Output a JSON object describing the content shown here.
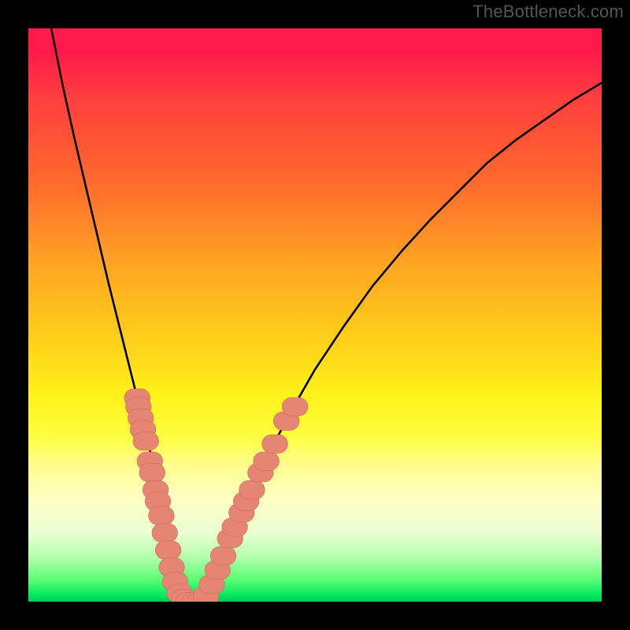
{
  "watermark": "TheBottleneck.com",
  "colors": {
    "curve_stroke": "#000000",
    "marker_fill": "#e58574",
    "marker_stroke": "#d06a5a"
  },
  "chart_data": {
    "type": "line",
    "title": "",
    "xlabel": "",
    "ylabel": "",
    "xlim": [
      0,
      100
    ],
    "ylim": [
      0,
      100
    ],
    "legend": false,
    "grid": false,
    "series": [
      {
        "name": "bottleneck-curve",
        "x": [
          4,
          6,
          8,
          10,
          12,
          14,
          16,
          18,
          20,
          22,
          24,
          25,
          26,
          27,
          28,
          30,
          32,
          34,
          36,
          38,
          42,
          46,
          50,
          55,
          60,
          65,
          70,
          75,
          80,
          85,
          90,
          95,
          100
        ],
        "y": [
          100,
          90,
          81,
          72.5,
          64,
          55.5,
          47.5,
          39.5,
          31.5,
          23,
          14,
          9,
          5,
          2,
          0,
          0,
          3,
          7,
          12,
          17,
          26,
          33.5,
          40.5,
          48,
          55,
          61,
          66.5,
          71.5,
          76.5,
          80.5,
          84,
          87.5,
          90.5
        ]
      }
    ],
    "markers": [
      {
        "x": 19.0,
        "y": 35.5,
        "r": 1.4
      },
      {
        "x": 19.2,
        "y": 34.0,
        "r": 1.4
      },
      {
        "x": 19.6,
        "y": 32.0,
        "r": 1.4
      },
      {
        "x": 20.0,
        "y": 30.0,
        "r": 1.4
      },
      {
        "x": 20.5,
        "y": 28.0,
        "r": 1.4
      },
      {
        "x": 21.2,
        "y": 24.5,
        "r": 1.4
      },
      {
        "x": 21.6,
        "y": 22.5,
        "r": 1.4
      },
      {
        "x": 22.2,
        "y": 19.5,
        "r": 1.4
      },
      {
        "x": 22.6,
        "y": 17.5,
        "r": 1.4
      },
      {
        "x": 23.2,
        "y": 15.0,
        "r": 1.4
      },
      {
        "x": 23.8,
        "y": 12.0,
        "r": 1.4
      },
      {
        "x": 24.4,
        "y": 9.0,
        "r": 1.4
      },
      {
        "x": 25.0,
        "y": 6.0,
        "r": 1.4
      },
      {
        "x": 25.6,
        "y": 3.5,
        "r": 1.4
      },
      {
        "x": 26.4,
        "y": 1.5,
        "r": 1.4
      },
      {
        "x": 27.2,
        "y": 0.5,
        "r": 1.4
      },
      {
        "x": 28.0,
        "y": 0.0,
        "r": 1.4
      },
      {
        "x": 29.0,
        "y": 0.0,
        "r": 1.4
      },
      {
        "x": 30.0,
        "y": 0.0,
        "r": 1.4
      },
      {
        "x": 31.0,
        "y": 1.0,
        "r": 1.4
      },
      {
        "x": 32.0,
        "y": 3.0,
        "r": 1.4
      },
      {
        "x": 33.0,
        "y": 5.5,
        "r": 1.4
      },
      {
        "x": 34.0,
        "y": 8.0,
        "r": 1.4
      },
      {
        "x": 35.2,
        "y": 11.0,
        "r": 1.4
      },
      {
        "x": 36.0,
        "y": 13.0,
        "r": 1.4
      },
      {
        "x": 37.2,
        "y": 15.5,
        "r": 1.4
      },
      {
        "x": 38.0,
        "y": 17.5,
        "r": 1.4
      },
      {
        "x": 39.0,
        "y": 19.5,
        "r": 1.4
      },
      {
        "x": 40.5,
        "y": 22.5,
        "r": 1.4
      },
      {
        "x": 41.5,
        "y": 24.5,
        "r": 1.4
      },
      {
        "x": 43.0,
        "y": 27.5,
        "r": 1.4
      },
      {
        "x": 45.0,
        "y": 31.5,
        "r": 1.4
      },
      {
        "x": 46.5,
        "y": 34.0,
        "r": 1.4
      }
    ]
  }
}
